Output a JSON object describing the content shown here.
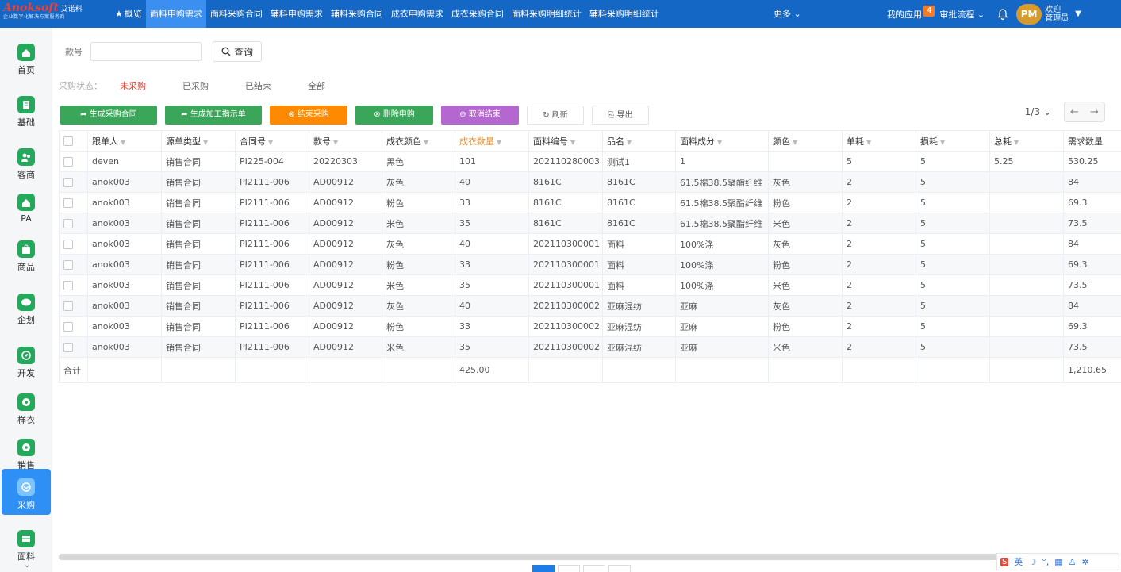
{
  "brand": {
    "name": "Anoksoft",
    "cn": "艾诺科",
    "tagline": "企业数字化解决方案服务商"
  },
  "nav": {
    "items": [
      {
        "label": "概览",
        "star": true
      },
      {
        "label": "面料申购需求",
        "active": true
      },
      {
        "label": "面料采购合同"
      },
      {
        "label": "辅料申购需求"
      },
      {
        "label": "辅料采购合同"
      },
      {
        "label": "成衣申购需求"
      },
      {
        "label": "成衣采购合同"
      },
      {
        "label": "面料采购明细统计"
      },
      {
        "label": "辅料采购明细统计"
      }
    ],
    "more": "更多",
    "my_apps": "我的应用",
    "app_count": "4",
    "approval": "审批流程",
    "avatar": "PM",
    "welcome": "欢迎",
    "user": "管理员"
  },
  "sidebar": {
    "items": [
      {
        "label": "首页",
        "icon": "home-icon"
      },
      {
        "label": "基础",
        "icon": "document-icon"
      },
      {
        "label": "客商",
        "icon": "users-icon"
      },
      {
        "label": "PA",
        "icon": "home-icon"
      },
      {
        "label": "商品",
        "icon": "shopping-bag-icon"
      },
      {
        "label": "企划",
        "icon": "palette-icon"
      },
      {
        "label": "开发",
        "icon": "compass-icon"
      },
      {
        "label": "样衣",
        "icon": "sample-icon"
      },
      {
        "label": "销售",
        "icon": "disc-icon"
      },
      {
        "label": "采购",
        "icon": "shield-icon",
        "active": true
      },
      {
        "label": "面料",
        "icon": "fabric-icon"
      }
    ]
  },
  "filter": {
    "style_label": "款号",
    "style_value": "",
    "query": "查询"
  },
  "status": {
    "label": "采购状态：",
    "options": [
      {
        "label": "未采购",
        "selected": true
      },
      {
        "label": "已采购"
      },
      {
        "label": "已结束"
      },
      {
        "label": "全部"
      }
    ]
  },
  "toolbar": {
    "buttons": [
      {
        "label": "生成采购合同",
        "style": "green",
        "icon": "share-icon"
      },
      {
        "label": "生成加工指示单",
        "style": "green",
        "icon": "share-icon"
      },
      {
        "label": "结束采购",
        "style": "orange",
        "icon": "close-circle-icon"
      },
      {
        "label": "删除申购",
        "style": "green",
        "icon": "close-circle-icon"
      },
      {
        "label": "取消结束",
        "style": "purple",
        "icon": "minus-circle-icon"
      },
      {
        "label": "刷新",
        "style": "plain",
        "icon": "refresh-icon"
      },
      {
        "label": "导出",
        "style": "plain",
        "icon": "export-icon"
      }
    ],
    "pager": "1/3"
  },
  "table": {
    "columns": [
      {
        "label": "跟单人",
        "sort": true
      },
      {
        "label": "源单类型",
        "sort": true
      },
      {
        "label": "合同号",
        "sort": true
      },
      {
        "label": "款号",
        "sort": true
      },
      {
        "label": "成衣颜色",
        "sort": true
      },
      {
        "label": "成衣数量",
        "sort": true,
        "highlight": true
      },
      {
        "label": "面料编号",
        "sort": true
      },
      {
        "label": "品名",
        "sort": true
      },
      {
        "label": "面料成分",
        "sort": true
      },
      {
        "label": "颜色",
        "sort": true
      },
      {
        "label": "单耗",
        "sort": true
      },
      {
        "label": "损耗",
        "sort": true
      },
      {
        "label": "总耗",
        "sort": true
      },
      {
        "label": "需求数量",
        "sort": false
      }
    ],
    "rows": [
      [
        "deven",
        "销售合同",
        "PI225-004",
        "20220303",
        "黑色",
        "101",
        "202110280003",
        "测试1",
        "1",
        "",
        "5",
        "5",
        "5.25",
        "530.25"
      ],
      [
        "anok003",
        "销售合同",
        "PI2111-006",
        "AD00912",
        "灰色",
        "40",
        "8161C",
        "8161C",
        "61.5棉38.5聚酯纤维",
        "灰色",
        "2",
        "5",
        "",
        "84"
      ],
      [
        "anok003",
        "销售合同",
        "PI2111-006",
        "AD00912",
        "粉色",
        "33",
        "8161C",
        "8161C",
        "61.5棉38.5聚酯纤维",
        "粉色",
        "2",
        "5",
        "",
        "69.3"
      ],
      [
        "anok003",
        "销售合同",
        "PI2111-006",
        "AD00912",
        "米色",
        "35",
        "8161C",
        "8161C",
        "61.5棉38.5聚酯纤维",
        "米色",
        "2",
        "5",
        "",
        "73.5"
      ],
      [
        "anok003",
        "销售合同",
        "PI2111-006",
        "AD00912",
        "灰色",
        "40",
        "202110300001",
        "面料",
        "100%涤",
        "灰色",
        "2",
        "5",
        "",
        "84"
      ],
      [
        "anok003",
        "销售合同",
        "PI2111-006",
        "AD00912",
        "粉色",
        "33",
        "202110300001",
        "面料",
        "100%涤",
        "粉色",
        "2",
        "5",
        "",
        "69.3"
      ],
      [
        "anok003",
        "销售合同",
        "PI2111-006",
        "AD00912",
        "米色",
        "35",
        "202110300001",
        "面料",
        "100%涤",
        "米色",
        "2",
        "5",
        "",
        "73.5"
      ],
      [
        "anok003",
        "销售合同",
        "PI2111-006",
        "AD00912",
        "灰色",
        "40",
        "202110300002",
        "亚麻混纺",
        "亚麻",
        "灰色",
        "2",
        "5",
        "",
        "84"
      ],
      [
        "anok003",
        "销售合同",
        "PI2111-006",
        "AD00912",
        "粉色",
        "33",
        "202110300002",
        "亚麻混纺",
        "亚麻",
        "粉色",
        "2",
        "5",
        "",
        "69.3"
      ],
      [
        "anok003",
        "销售合同",
        "PI2111-006",
        "AD00912",
        "米色",
        "35",
        "202110300002",
        "亚麻混纺",
        "亚麻",
        "米色",
        "2",
        "5",
        "",
        "73.5"
      ]
    ],
    "footer": {
      "label": "合计",
      "qty_total": "425.00",
      "demand_total": "1,210.65"
    }
  },
  "ime": {
    "s": "S",
    "lang": "英"
  }
}
